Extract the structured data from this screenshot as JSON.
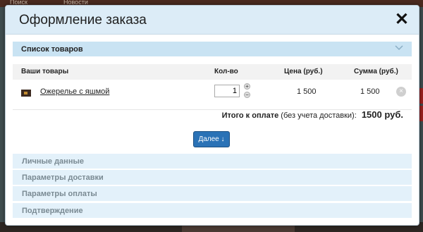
{
  "background": {
    "nav_items": [
      "Поиск",
      "Новости"
    ]
  },
  "modal": {
    "title": "Оформление заказа",
    "close_icon": "close-icon"
  },
  "cart_section": {
    "title": "Список товаров",
    "columns": {
      "product": "Ваши товары",
      "qty": "Кол-во",
      "price": "Цена (руб.)",
      "sum": "Сумма (руб.)"
    },
    "items": [
      {
        "name": "Ожерелье с яшмой",
        "qty": "1",
        "price": "1 500",
        "sum": "1 500"
      }
    ],
    "stepper_plus": "+",
    "stepper_minus": "−",
    "remove_symbol": "×",
    "total_label": "Итого к оплате",
    "total_note": " (без учета доставки): ",
    "total_value": "1500 руб.",
    "next_button": "Далее ↓"
  },
  "steps": [
    "Личные данные",
    "Параметры доставки",
    "Параметры оплаты",
    "Подтверждение"
  ],
  "colors": {
    "header_bg": "#dcecf7",
    "section_bg": "#c9e3f3",
    "step_bg": "#e3f1fa",
    "button_bg": "#2a72b6"
  }
}
